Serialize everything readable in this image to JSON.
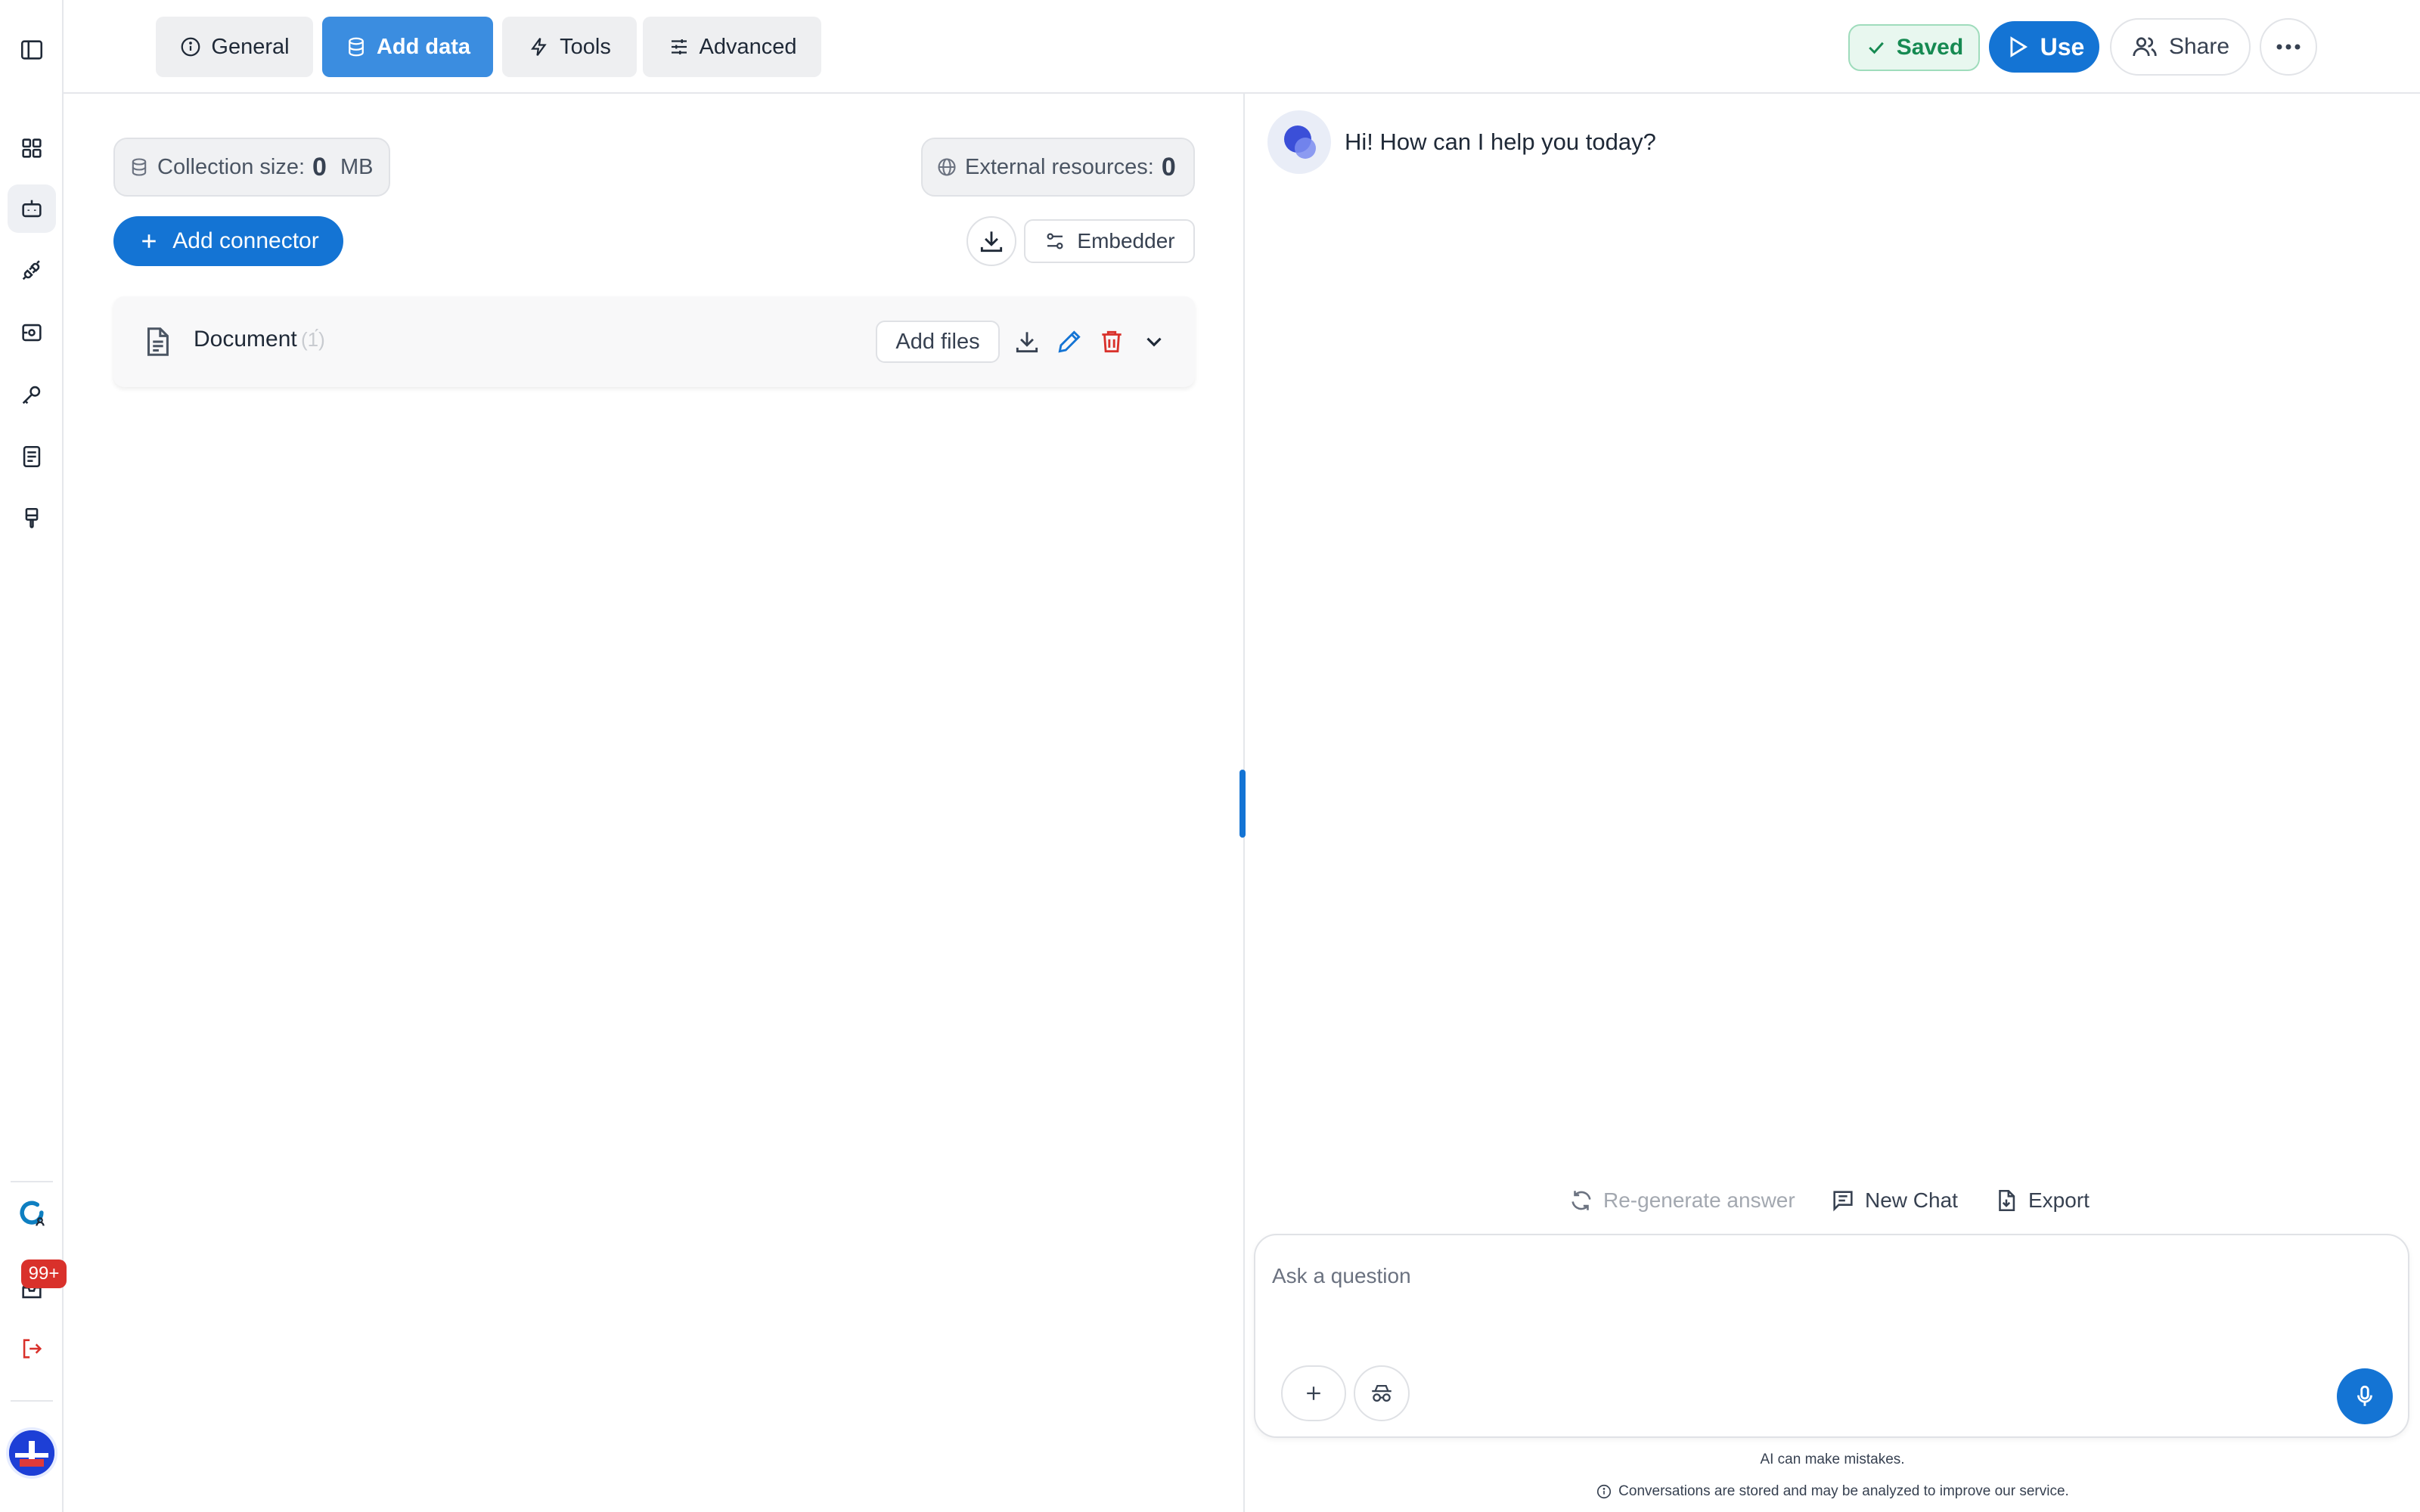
{
  "topbar": {
    "tabs": [
      {
        "label": "General",
        "icon": "info-icon",
        "active": false
      },
      {
        "label": "Add data",
        "icon": "database-icon",
        "active": true
      },
      {
        "label": "Tools",
        "icon": "lightning-icon",
        "active": false
      },
      {
        "label": "Advanced",
        "icon": "sliders-icon",
        "active": false
      }
    ],
    "saved_label": "Saved",
    "use_label": "Use",
    "share_label": "Share"
  },
  "sidebar": {
    "notification_count": "99+",
    "items": [
      {
        "icon": "panel-toggle-icon"
      },
      {
        "icon": "grid-icon"
      },
      {
        "icon": "bot-icon",
        "active": true
      },
      {
        "icon": "plug-icon"
      },
      {
        "icon": "scan-icon"
      },
      {
        "icon": "key-icon"
      },
      {
        "icon": "notebook-icon"
      },
      {
        "icon": "brush-icon"
      },
      {
        "icon": "search-users-icon"
      },
      {
        "icon": "inbox-icon"
      },
      {
        "icon": "logout-icon"
      }
    ]
  },
  "data_panel": {
    "collection_label": "Collection size:",
    "collection_value": "0",
    "collection_unit": "MB",
    "external_label": "External resources:",
    "external_value": "0",
    "add_connector_label": "Add connector",
    "embedder_label": "Embedder",
    "document": {
      "title": "Document",
      "count": "(1́)",
      "add_files_label": "Add files"
    }
  },
  "chat": {
    "greeting": "Hi! How can I help you today?",
    "regenerate_label": "Re-generate answer",
    "new_chat_label": "New Chat",
    "export_label": "Export",
    "input_placeholder": "Ask a question",
    "disclaimer": "AI can make mistakes.",
    "privacy_note": "Conversations are stored and may be analyzed to improve our service."
  },
  "colors": {
    "accent": "#1474d4",
    "active_tab": "#3b8de0",
    "saved_green": "#168a52",
    "danger": "#d9312b"
  }
}
